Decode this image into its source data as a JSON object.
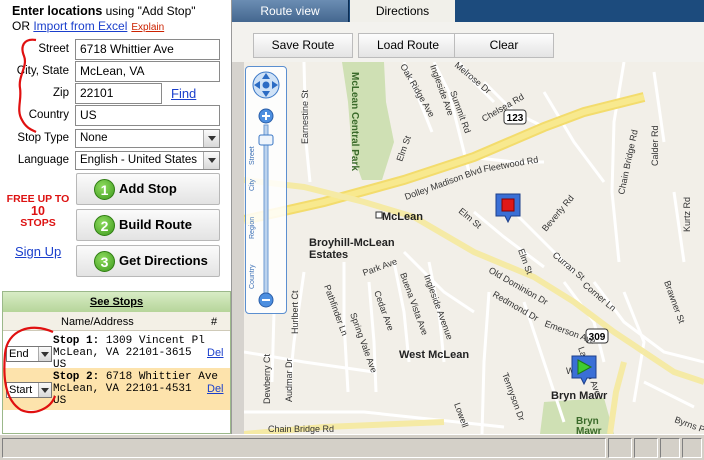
{
  "header": {
    "line1_bold": "Enter locations",
    "line1_rest": " using \"Add Stop\"",
    "line2_prefix": "OR ",
    "import_link": "Import from Excel",
    "explain_link": "Explain"
  },
  "form": {
    "street_label": "Street",
    "street_value": "6718 Whittier Ave",
    "city_label": "City, State",
    "city_value": "McLean, VA",
    "zip_label": "Zip",
    "zip_value": "22101",
    "find_link": "Find",
    "country_label": "Country",
    "country_value": "US",
    "stoptype_label": "Stop Type",
    "stoptype_value": "None",
    "language_label": "Language",
    "language_value": "English - United States"
  },
  "promo": {
    "line1": "FREE UP TO",
    "line2": "10",
    "line3": "STOPS",
    "signup": "Sign Up"
  },
  "actions": [
    {
      "num": "1",
      "label": "Add Stop"
    },
    {
      "num": "2",
      "label": "Build Route"
    },
    {
      "num": "3",
      "label": "Get Directions"
    }
  ],
  "stops": {
    "title": "See Stops",
    "col_name": "Name/Address",
    "col_del": "#",
    "rows": [
      {
        "role": "End",
        "title": "Stop 1:",
        "line1": " 1309 Vincent Pl",
        "line2": "McLean, VA 22101-3615",
        "line3": "US",
        "del": "Del",
        "bg": "#ffffff"
      },
      {
        "role": "Start",
        "title": "Stop 2:",
        "line1": " 6718 Whittier Ave",
        "line2": "McLean, VA 22101-4531",
        "line3": "US",
        "del": "Del",
        "bg": "#fde3ac"
      }
    ]
  },
  "tabs": {
    "route_view": "Route view",
    "directions": "Directions"
  },
  "toolbar": {
    "save": "Save Route",
    "load": "Load Route",
    "clear": "Clear"
  },
  "map": {
    "zoom_levels": {
      "street": "Street",
      "city": "City",
      "region": "Region",
      "country": "Country"
    },
    "labels": {
      "park": "McLean Central Park",
      "mclean": "McLean",
      "broyhill1": "Broyhill-McLean",
      "broyhill2": "Estates",
      "west_mclean": "West McLean",
      "bryn_mawr": "Bryn Mawr",
      "bryn_bottom": "Bryn",
      "bryn_bottom2": "Mawr",
      "dolley": "Dolley Madison Blvd",
      "old_dominion": "Old Dominion Dr",
      "chain_bridge": "Chain Bridge Rd",
      "chain_bridge2": "Chain Bridge Rd",
      "redmond": "Redmond Dr",
      "earnestine": "Earnestine St",
      "oak_ridge": "Oak Ridge Ave",
      "ingleside": "Ingleside Ave",
      "ingleside2": "Ingleside Avenue",
      "summit": "Summit Rd",
      "melrose": "Melrose Dr",
      "chelsea": "Chelsea Rd",
      "fleetwood": "Fleetwood Rd",
      "elm1": "Elm St",
      "elm2": "Elm St",
      "elm3": "Elm St",
      "beverly": "Beverly Rd",
      "curran": "Curran St",
      "corner": "Corner Ln",
      "calder": "Calder Rd",
      "kurtz": "Kurtz Rd",
      "brawner": "Brawner St",
      "park_ave": "Park Ave",
      "buena": "Buena Vista Ave",
      "cedar": "Cedar Ave",
      "spring": "Spring Vale Ave",
      "pathfinder": "Pathfinder Ln",
      "hurlbert": "Hurlbert Ct",
      "emerson": "Emerson Ave",
      "laughlin": "Laughlin Ave",
      "whann": "Whann",
      "tennyson": "Tennyson Dr",
      "byrns": "Byrns Pl",
      "dewberry": "Dewberry Ct",
      "audmar": "Audmar Dr",
      "lowell": "Lowell",
      "rte123": "123",
      "rte309": "309"
    }
  }
}
